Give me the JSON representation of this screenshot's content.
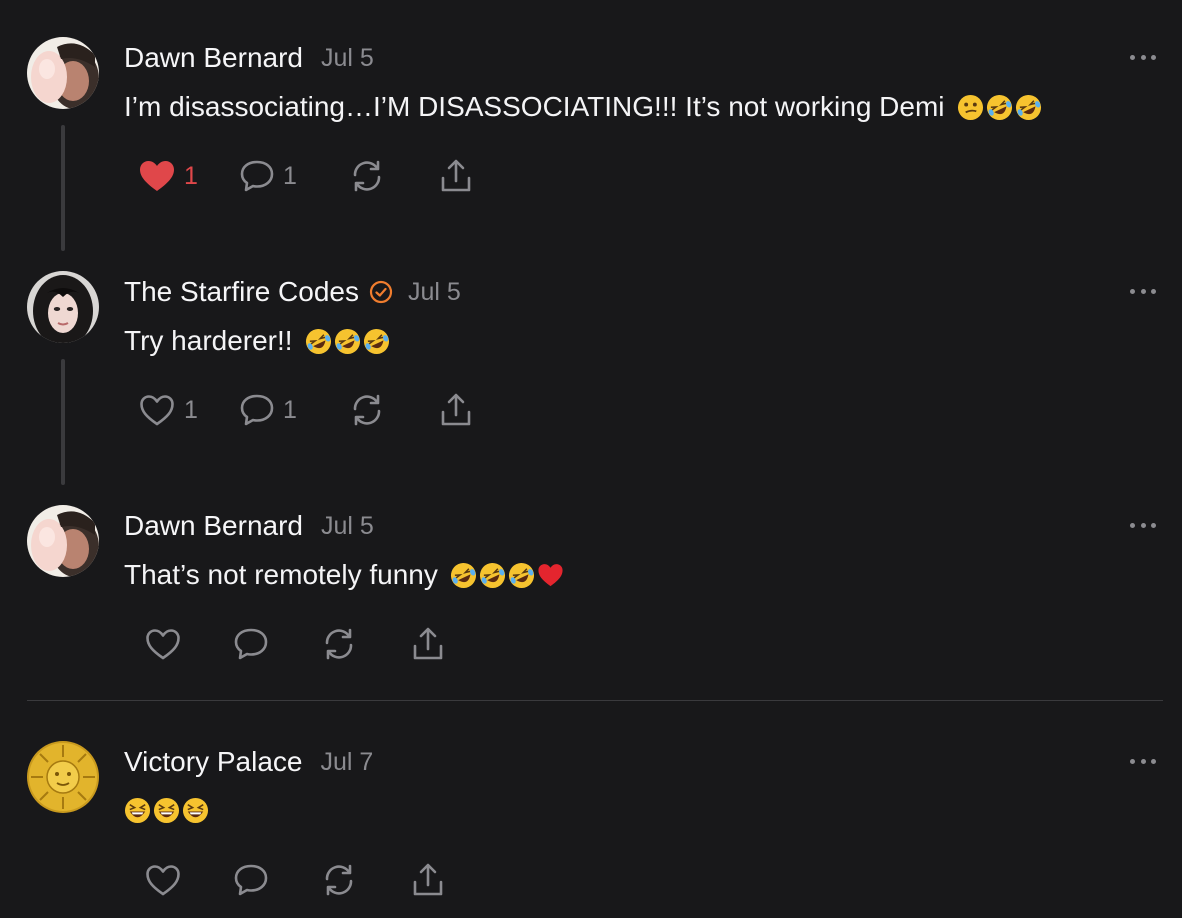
{
  "comments": [
    {
      "author": "Dawn Bernard",
      "date": "Jul 5",
      "text": "I’m disassociating…I’M DISASSOCIATING!!! It’s not working Demi",
      "emojis": [
        "confused-face",
        "rolling-laughing-face",
        "rolling-laughing-face"
      ],
      "likes": "1",
      "replies": "1",
      "liked": true,
      "verified": false
    },
    {
      "author": "The Starfire Codes",
      "date": "Jul 5",
      "text": "Try harderer!!",
      "emojis": [
        "rolling-laughing-face",
        "rolling-laughing-face",
        "rolling-laughing-face"
      ],
      "likes": "1",
      "replies": "1",
      "liked": false,
      "verified": true
    },
    {
      "author": "Dawn Bernard",
      "date": "Jul 5",
      "text": "That’s not remotely funny",
      "emojis": [
        "rolling-laughing-face",
        "rolling-laughing-face",
        "rolling-laughing-face",
        "red-heart"
      ],
      "likes": "",
      "replies": "",
      "liked": false,
      "verified": false
    },
    {
      "author": "Victory Palace",
      "date": "Jul 7",
      "text": "",
      "emojis": [
        "grinning-squinting-face",
        "grinning-squinting-face",
        "grinning-squinting-face"
      ],
      "likes": "",
      "replies": "",
      "liked": false,
      "verified": false
    }
  ],
  "colors": {
    "background": "#18181a",
    "text": "#f4f4f6",
    "muted": "#8b8b90",
    "like_active": "#e0474a",
    "verified_badge": "#f07d2e",
    "thread_line": "#3a3a3d"
  },
  "icons": {
    "like": "heart-icon",
    "reply": "speech-bubble-icon",
    "restack": "restack-icon",
    "share": "share-icon",
    "more": "more-dots-icon"
  }
}
